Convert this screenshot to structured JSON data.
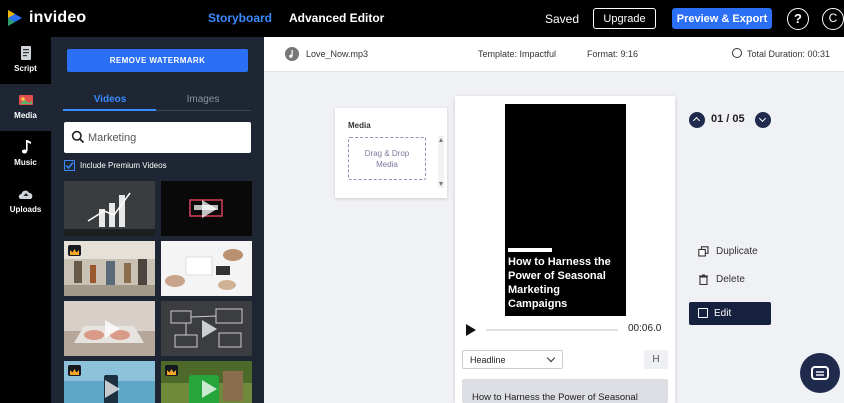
{
  "app": {
    "name": "invideo",
    "logo_colors": [
      "#2b6ff5",
      "#2e9e6a",
      "#f5b400"
    ]
  },
  "topbar": {
    "tabs": [
      {
        "label": "Storyboard",
        "active": true
      },
      {
        "label": "Advanced Editor",
        "active": false
      }
    ],
    "status": "Saved",
    "upgrade_label": "Upgrade",
    "export_label": "Preview & Export",
    "help_label": "?",
    "avatar_initial": "C"
  },
  "leftnav": {
    "items": [
      {
        "label": "Script",
        "icon": "document-icon",
        "active": false
      },
      {
        "label": "Media",
        "icon": "media-icon",
        "active": true
      },
      {
        "label": "Music",
        "icon": "music-note-icon",
        "active": false
      },
      {
        "label": "Uploads",
        "icon": "cloud-upload-icon",
        "active": false
      }
    ]
  },
  "media_panel": {
    "watermark_button": "REMOVE WATERMARK",
    "tabs": [
      {
        "label": "Videos",
        "active": true
      },
      {
        "label": "Images",
        "active": false
      }
    ],
    "search": {
      "value": "Marketing",
      "icon": "search-icon"
    },
    "premium_checkbox": {
      "label": "Include Premium Videos",
      "checked": true
    },
    "thumbnails": [
      {
        "premium": false,
        "play": false,
        "theme": "chalkboard-chart"
      },
      {
        "premium": false,
        "play": true,
        "theme": "video-play-sign"
      },
      {
        "premium": true,
        "play": false,
        "theme": "market-street"
      },
      {
        "premium": false,
        "play": false,
        "theme": "desk-meeting"
      },
      {
        "premium": false,
        "play": true,
        "theme": "laptop-typing"
      },
      {
        "premium": false,
        "play": true,
        "theme": "sketch-diagram"
      },
      {
        "premium": true,
        "play": true,
        "theme": "phone-water"
      },
      {
        "premium": true,
        "play": true,
        "theme": "green-screen-phone"
      }
    ]
  },
  "infobar": {
    "audio_file": "Love_Now.mp3",
    "template": "Template: Impactful",
    "format": "Format: 9:16",
    "duration": "Total Duration: 00:31"
  },
  "media_card": {
    "title": "Media",
    "drop_line1": "Drag & Drop",
    "drop_line2": "Media"
  },
  "scene": {
    "headline": "How to Harness the Power of Seasonal Marketing Campaigns",
    "timecode": "00:06.0",
    "text_style": "Headline",
    "heading_toggle": "H",
    "text_preview": "How to Harness the Power of Seasonal",
    "counter": "01 / 05"
  },
  "scene_actions": {
    "duplicate_label": "Duplicate",
    "delete_label": "Delete",
    "edit_label": "Edit"
  },
  "colors": {
    "accent": "#2b6ff5",
    "panel": "#1e2633",
    "navy": "#16213f"
  }
}
